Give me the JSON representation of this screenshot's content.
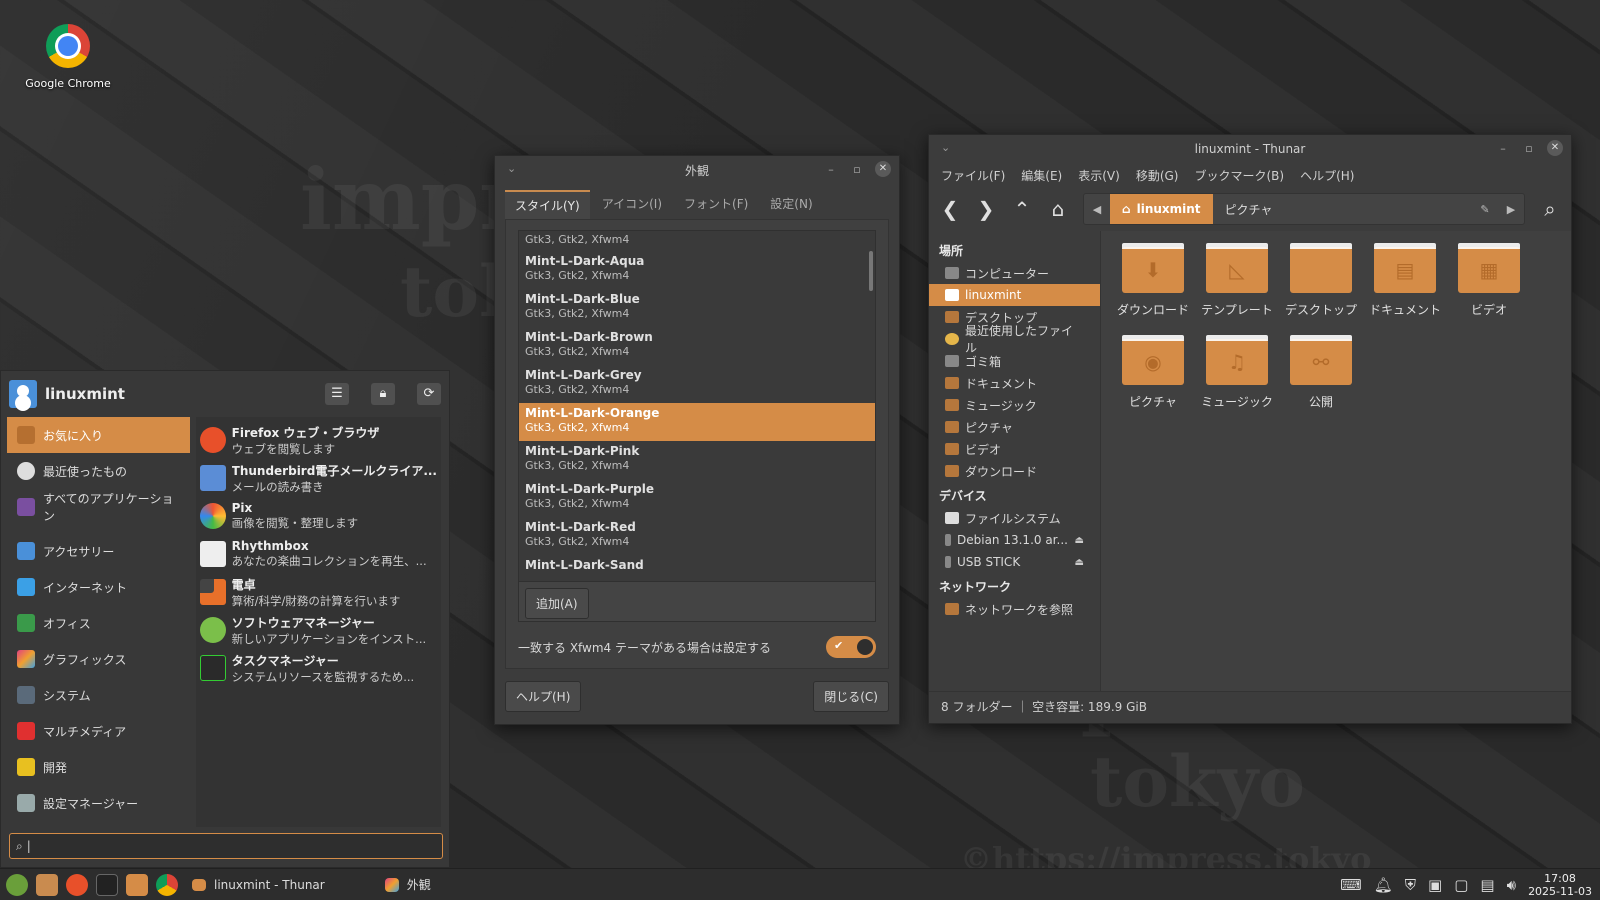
{
  "desktop": {
    "chrome_label": "Google Chrome"
  },
  "watermark": {
    "line1": "impress",
    "line2": "tokyo",
    "url": "©https://impress.tokyo"
  },
  "appearance": {
    "title": "外観",
    "tabs": [
      "スタイル(Y)",
      "アイコン(I)",
      "フォント(F)",
      "設定(N)"
    ],
    "themes": [
      {
        "name": "",
        "sub": "Gtk3, Gtk2, Xfwm4"
      },
      {
        "name": "Mint-L-Dark-Aqua",
        "sub": "Gtk3, Gtk2, Xfwm4"
      },
      {
        "name": "Mint-L-Dark-Blue",
        "sub": "Gtk3, Gtk2, Xfwm4"
      },
      {
        "name": "Mint-L-Dark-Brown",
        "sub": "Gtk3, Gtk2, Xfwm4"
      },
      {
        "name": "Mint-L-Dark-Grey",
        "sub": "Gtk3, Gtk2, Xfwm4"
      },
      {
        "name": "Mint-L-Dark-Orange",
        "sub": "Gtk3, Gtk2, Xfwm4"
      },
      {
        "name": "Mint-L-Dark-Pink",
        "sub": "Gtk3, Gtk2, Xfwm4"
      },
      {
        "name": "Mint-L-Dark-Purple",
        "sub": "Gtk3, Gtk2, Xfwm4"
      },
      {
        "name": "Mint-L-Dark-Red",
        "sub": "Gtk3, Gtk2, Xfwm4"
      },
      {
        "name": "Mint-L-Dark-Sand",
        "sub": ""
      }
    ],
    "add_button": "追加(A)",
    "toggle_label": "一致する Xfwm4 テーマがある場合は設定する",
    "help_button": "ヘルプ(H)",
    "close_button": "閉じる(C)"
  },
  "thunar": {
    "title": "linuxmint - Thunar",
    "menu": [
      "ファイル(F)",
      "編集(E)",
      "表示(V)",
      "移動(G)",
      "ブックマーク(B)",
      "ヘルプ(H)"
    ],
    "crumb_active": "linuxmint",
    "crumb_next": "ピクチャ",
    "places_head": "場所",
    "places": [
      "コンピューター",
      "linuxmint",
      "デスクトップ",
      "最近使用したファイル",
      "ゴミ箱",
      "ドキュメント",
      "ミュージック",
      "ピクチャ",
      "ビデオ",
      "ダウンロード"
    ],
    "devices_head": "デバイス",
    "devices": [
      "ファイルシステム",
      "Debian 13.1.0 ar...",
      "USB STICK"
    ],
    "network_head": "ネットワーク",
    "network": [
      "ネットワークを参照"
    ],
    "folders": [
      "ダウンロード",
      "テンプレート",
      "デスクトップ",
      "ドキュメント",
      "ビデオ",
      "ピクチャ",
      "ミュージック",
      "公開"
    ],
    "status": "8 フォルダー ｜ 空き容量: 189.9 GiB"
  },
  "menu": {
    "user": "linuxmint",
    "categories": [
      "お気に入り",
      "最近使ったもの",
      "すべてのアプリケーション",
      "アクセサリー",
      "インターネット",
      "オフィス",
      "グラフィックス",
      "システム",
      "マルチメディア",
      "開発",
      "設定マネージャー"
    ],
    "apps": [
      {
        "name": "Firefox ウェブ・ブラウザ",
        "desc": "ウェブを閲覧します"
      },
      {
        "name": "Thunderbird電子メールクライア...",
        "desc": "メールの読み書き"
      },
      {
        "name": "Pix",
        "desc": "画像を閲覧・整理します"
      },
      {
        "name": "Rhythmbox",
        "desc": "あなたの楽曲コレクションを再生、..."
      },
      {
        "name": "電卓",
        "desc": "算術/科学/財務の計算を行います"
      },
      {
        "name": "ソフトウェアマネージャー",
        "desc": "新しいアプリケーションをインスト..."
      },
      {
        "name": "タスクマネージャー",
        "desc": "システムリソースを監視するため..."
      }
    ],
    "search_value": "|"
  },
  "taskbar": {
    "tasks": [
      "linuxmint - Thunar",
      "外観"
    ],
    "time": "17:08",
    "date": "2025-11-03"
  },
  "colors": {
    "accent": "#d58c47"
  }
}
